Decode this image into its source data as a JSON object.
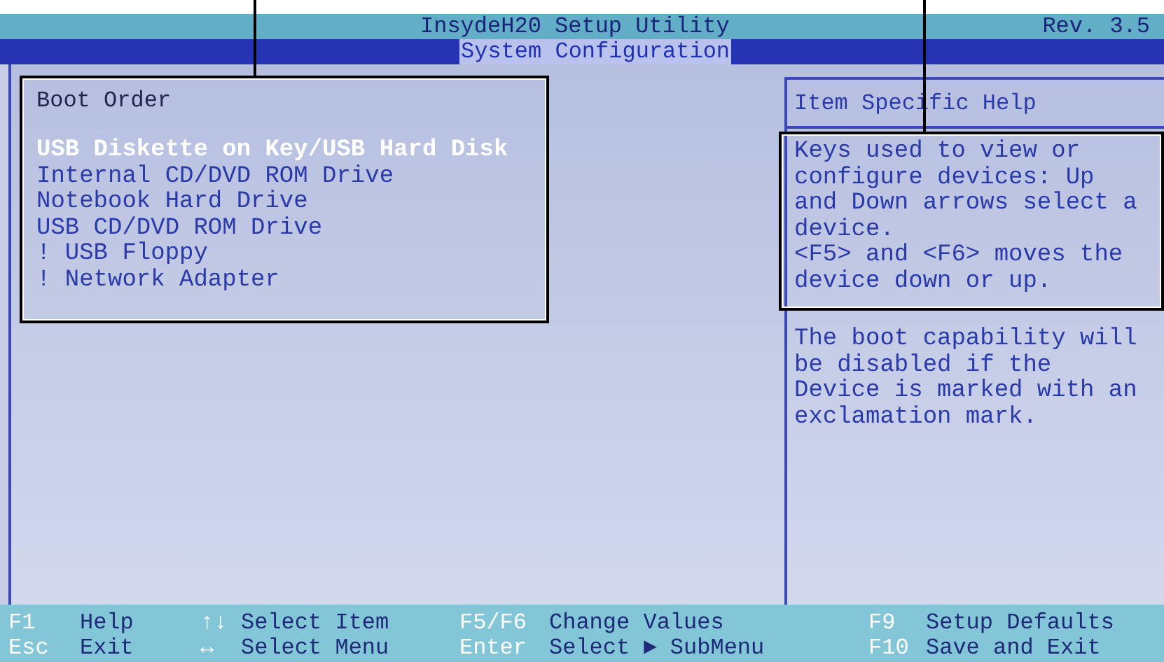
{
  "header": {
    "title": "InsydeH20 Setup Utility",
    "revision": "Rev. 3.5"
  },
  "tabs": [
    {
      "label": "System Configuration",
      "selected": true
    }
  ],
  "boot_order": {
    "title": "Boot Order",
    "items": [
      {
        "label": "USB Diskette on Key/USB Hard Disk",
        "selected": true
      },
      {
        "label": "Internal CD/DVD ROM Drive",
        "selected": false
      },
      {
        "label": "Notebook Hard Drive",
        "selected": false
      },
      {
        "label": "USB CD/DVD ROM Drive",
        "selected": false
      },
      {
        "label": "! USB Floppy",
        "selected": false
      },
      {
        "label": "! Network Adapter",
        "selected": false
      }
    ]
  },
  "help": {
    "title": "Item Specific Help",
    "sections": [
      {
        "paragraphs": [
          "Keys used to view or configure devices: Up and Down arrows select a device.",
          "<F5> and <F6> moves the device down or up."
        ]
      },
      {
        "paragraphs": [
          "The boot capability will be disabled if the Device is marked with an exclamation mark."
        ]
      }
    ]
  },
  "footer": {
    "keys": [
      {
        "key": "F1",
        "action": "Help"
      },
      {
        "key": "Esc",
        "action": "Exit"
      },
      {
        "key": "↑↓",
        "action": "Select Item"
      },
      {
        "key": "↔",
        "action": "Select Menu"
      },
      {
        "key": "F5/F6",
        "action": "Change Values"
      },
      {
        "key": "Enter",
        "action": "Select ► SubMenu"
      },
      {
        "key": "F9",
        "action": "Setup Defaults"
      },
      {
        "key": "F10",
        "action": "Save and Exit"
      }
    ]
  }
}
